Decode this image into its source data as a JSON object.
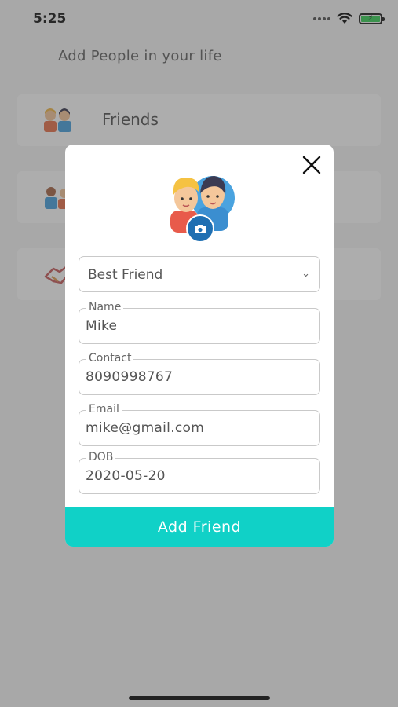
{
  "status_bar": {
    "time": "5:25",
    "battery_icon": "battery-charging-icon",
    "wifi_icon": "wifi-icon",
    "signal_icon": "signal-dots-icon"
  },
  "background": {
    "heading": "Add People in your life",
    "cards": [
      {
        "label": "Friends",
        "icon": "friends-icon"
      },
      {
        "label": "",
        "icon": "family-icon"
      },
      {
        "label": "",
        "icon": "handshake-icon"
      }
    ]
  },
  "modal": {
    "close_icon": "close-icon",
    "avatar_icon": "friends-avatar-icon",
    "camera_icon": "camera-icon",
    "relation_select": {
      "value": "Best Friend"
    },
    "fields": {
      "name": {
        "label": "Name",
        "value": "Mike"
      },
      "contact": {
        "label": "Contact",
        "value": "8090998767"
      },
      "email": {
        "label": "Email",
        "value": "mike@gmail.com"
      },
      "dob": {
        "label": "DOB",
        "value": "2020-05-20"
      }
    },
    "submit_label": "Add Friend"
  },
  "colors": {
    "accent": "#10d1c7",
    "camera": "#1f6fb2",
    "overlay": "#a8a8a8"
  }
}
